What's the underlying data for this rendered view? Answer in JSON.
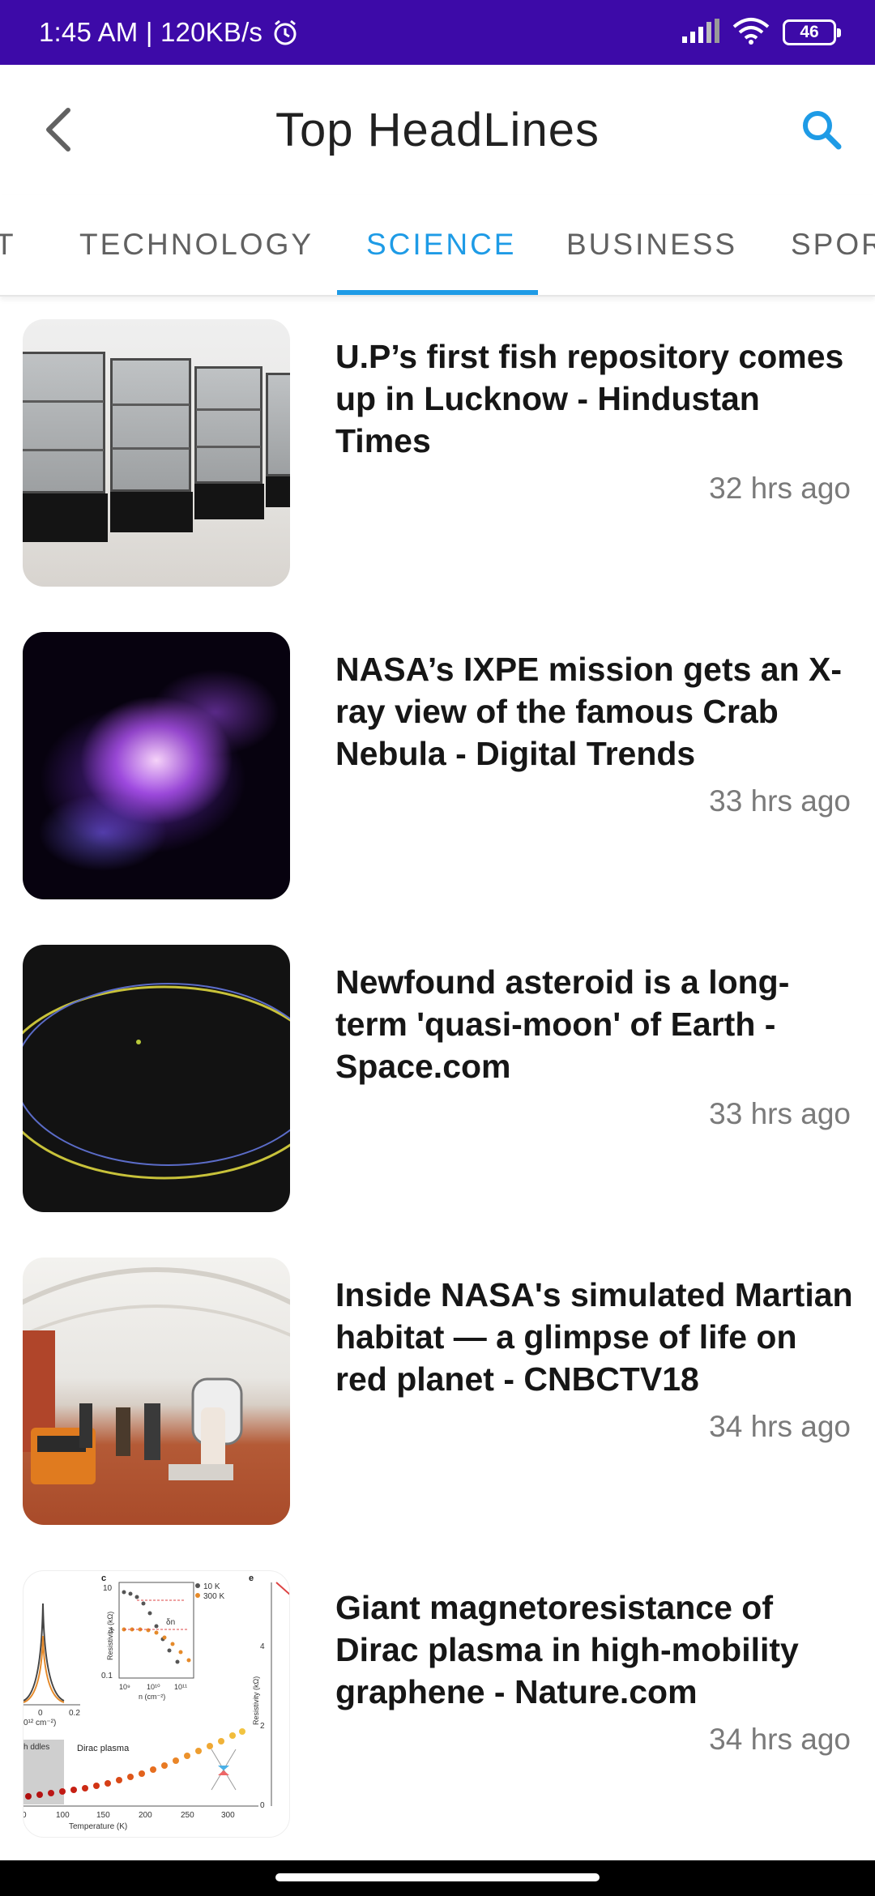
{
  "status_bar": {
    "time_speed": "1:45 AM | 120KB/s",
    "battery": "46",
    "icons": [
      "alarm-icon",
      "signal-icon",
      "wifi-icon",
      "battery-icon"
    ]
  },
  "toolbar": {
    "title": "Top HeadLines",
    "back_icon": "back-arrow-icon",
    "search_icon": "search-icon"
  },
  "tabs": {
    "items": [
      "T",
      "TECHNOLOGY",
      "SCIENCE",
      "BUSINESS",
      "SPOR"
    ],
    "active": "SCIENCE",
    "accent_color": "#1e9be6"
  },
  "news": [
    {
      "headline": "U.P’s first fish repository comes up in Lucknow - Hindustan Times",
      "time": "32 hrs ago"
    },
    {
      "headline": "NASA’s IXPE mission gets an X-ray view of the famous Crab Nebula - Digital Trends",
      "time": "33 hrs ago"
    },
    {
      "headline": "Newfound asteroid is a long-term 'quasi-moon' of Earth - Space.com",
      "time": "33 hrs ago"
    },
    {
      "headline": "Inside NASA's simulated Martian habitat — a glimpse of life on red planet - CNBCTV18",
      "time": "34 hrs ago"
    },
    {
      "headline": "Giant magnetoresistance of Dirac plasma in high-mobility graphene - Nature.com",
      "time": "34 hrs ago"
    }
  ],
  "graph_thumb": {
    "panel_c": "c",
    "panel_e": "e",
    "legend_10k": "10 K",
    "legend_300k": "300 K",
    "ylabel": "Resistivity (kΩ)",
    "xlabel_n": "n (cm⁻²)",
    "dirac_label": "Dirac plasma",
    "puddles_label": "h\nddles",
    "temperature_label": "Temperature (K)",
    "delta_n": "δn",
    "ticks_t": [
      "0",
      "100",
      "150",
      "200",
      "250",
      "300"
    ],
    "ticks_e": [
      "4",
      "2",
      "0"
    ],
    "tick_c_top": "10",
    "tick_c_mid": "1",
    "tick_c_low": "0.1",
    "tick_0_2": "0.2",
    "tick_0": "0",
    "tick_left": "0¹² cm⁻²)",
    "ticks_n": [
      "10⁹",
      "10¹⁰",
      "10¹¹"
    ]
  }
}
